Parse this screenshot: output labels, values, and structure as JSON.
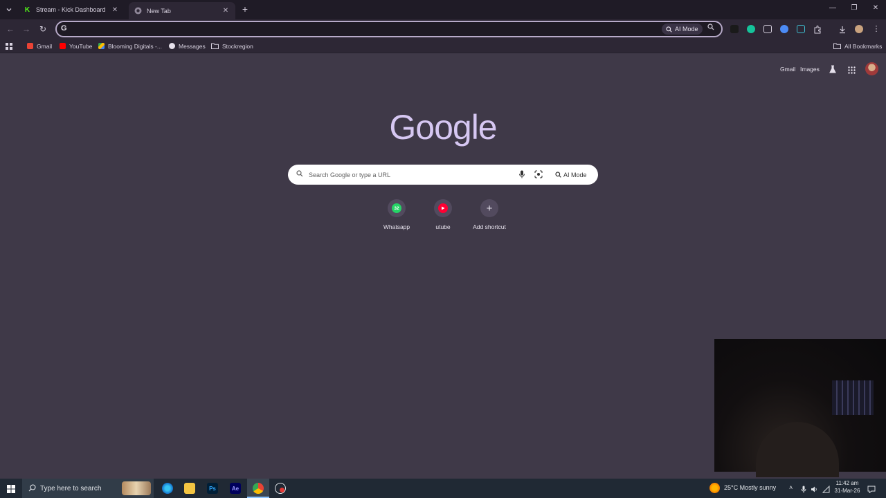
{
  "browser": {
    "tabs": [
      {
        "title": "Stream - Kick Dashboard",
        "favicon": "kick-icon",
        "active": false
      },
      {
        "title": "New Tab",
        "favicon": "chrome-icon",
        "active": true
      }
    ],
    "omnibox": {
      "value": "",
      "ai_mode_label": "AI Mode"
    },
    "bookmarks": [
      {
        "label": "Gmail",
        "icon": "gmail-icon",
        "color": "#ea4335"
      },
      {
        "label": "YouTube",
        "icon": "youtube-icon",
        "color": "#ff0000"
      },
      {
        "label": "Blooming Digitals -...",
        "icon": "drive-icon",
        "color": "#34a853"
      },
      {
        "label": "Messages",
        "icon": "messages-icon",
        "color": "#8ab4f8"
      },
      {
        "label": "Stockregion",
        "icon": "folder-icon",
        "color": "#d6d0de"
      }
    ],
    "all_bookmarks_label": "All Bookmarks"
  },
  "page": {
    "top_links": {
      "gmail": "Gmail",
      "images": "Images"
    },
    "logo": "Google",
    "search": {
      "placeholder": "Search Google or type a URL",
      "ai_mode_label": "AI Mode"
    },
    "shortcuts": [
      {
        "label": "Whatsapp",
        "icon": "whatsapp-icon",
        "badge": "32",
        "color": "#25d366"
      },
      {
        "label": "utube",
        "icon": "youtube-icon",
        "color": "#ff0033"
      },
      {
        "label": "Add shortcut",
        "icon": "plus-icon"
      }
    ]
  },
  "taskbar": {
    "search_placeholder": "Type here to search",
    "weather": "25°C  Mostly sunny",
    "time": "11:42 am",
    "date": "31-Mar-26"
  }
}
